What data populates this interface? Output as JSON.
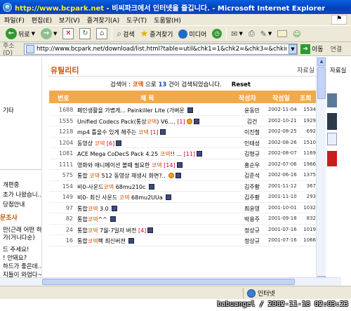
{
  "window": {
    "title": "비씨파크에서 인터넷을 즐깁니다. - Microsoft Internet Explorer",
    "title_url": "http://www.bcpark.net",
    "title_sep": " - "
  },
  "menu": {
    "items": [
      "파일(F)",
      "편집(E)",
      "보기(V)",
      "즐겨찾기(A)",
      "도구(T)",
      "도움말(H)"
    ]
  },
  "toolbar": {
    "back_label": "뒤로",
    "search_label": "검색",
    "favorites_label": "즐겨찾기",
    "media_label": "미디어"
  },
  "address": {
    "label": "주소(D)",
    "url": "http://www.bcpark.net/download/list.html?table=util&chk1=1&chk2=&chk3=&chkinum=&key=%C",
    "go_label": "이동",
    "links_label": "연결"
  },
  "left_frame": {
    "top_item": "기타",
    "items_mid": [
      "개편중",
      "초가 나왔습니..",
      "당첨안내"
    ],
    "heading": "문조사",
    "items_bottom": [
      "만(근래 어떤 하드",
      "가(거니다순)",
      "드 주세요!",
      "! 안돼요?",
      "하드가 좋은데..",
      "지들이 와멈다~"
    ]
  },
  "content": {
    "section_title": "유틸리티",
    "right_link": "자료실",
    "search": {
      "prefix": "검색어 : ",
      "keyword": "코덱",
      "middle": " 으로 ",
      "count": "13",
      "suffix": " 건이 검색되었습니다.",
      "reset": "Reset"
    },
    "table_headers": {
      "num": "번호",
      "title": "제          목",
      "writer": "작성자",
      "date": "작성일",
      "views": "조회"
    },
    "rows": [
      {
        "num": "1688",
        "pre": "페인생활을 가볍게... Painkiller Lite (가벼운 ",
        "kw": "",
        "post": "",
        "comments": "",
        "writer": "윤동민",
        "date": "2002-11-04",
        "views": "1534",
        "badge": false
      },
      {
        "num": "1555",
        "pre": "Unified Codecs Pack(통상",
        "kw": "코덱",
        "post": ") V6.... ",
        "comments": "[1]",
        "writer": "김건",
        "date": "2002-10-21",
        "views": "1929",
        "badge": true
      },
      {
        "num": "1218",
        "pre": "mp4 틀을수 있게 해주는 ",
        "kw": "코덱",
        "post": " ",
        "comments": "[1]",
        "writer": "이진철",
        "date": "2002-08-25",
        "views": "692",
        "badge": false
      },
      {
        "num": "1204",
        "pre": "동영상 ",
        "kw": "코덱",
        "post": " ",
        "comments": "[6]",
        "writer": "인태성",
        "date": "2002-08-26",
        "views": "1510",
        "badge": false
      },
      {
        "num": "1081",
        "pre": "ACE Mega CoDecS Pack 4.25 ",
        "kw": "코덱",
        "post": "!! ... ",
        "comments": "[11]",
        "writer": "김형규",
        "date": "2002-08-07",
        "views": "1169",
        "badge": false
      },
      {
        "num": "1111",
        "pre": "영화와 애니메이션 볼때 필요한 ",
        "kw": "코덱",
        "post": " ",
        "comments": "[14]",
        "writer": "홍순우",
        "date": "2002-07-06",
        "views": "1966",
        "badge": false
      },
      {
        "num": "575",
        "pre": "통합 ",
        "kw": "코덱",
        "post": " 512 동영상 재생시 화면?.. ",
        "comments": "",
        "writer": "김준석",
        "date": "2002-06-16",
        "views": "1375",
        "badge": true
      },
      {
        "num": "154",
        "pre": "비0-사운드",
        "kw": "코덱",
        "post": " 68mu210c ",
        "comments": "",
        "writer": "김주황",
        "date": "2001-11-12",
        "views": "367",
        "badge": false
      },
      {
        "num": "149",
        "pre": "비0- 최신 사운드 ",
        "kw": "코덱",
        "post": " 68mu2UUa ",
        "comments": "",
        "writer": "김주황",
        "date": "2001-11-10",
        "views": "293",
        "badge": false
      },
      {
        "num": "97",
        "pre": "통합",
        "kw": "코덱",
        "post": " 3.0 ",
        "comments": "",
        "writer": "최윤영",
        "date": "2001-10-01",
        "views": "1032",
        "badge": false
      },
      {
        "num": "82",
        "pre": "통합",
        "kw": "코덱",
        "post": "^^ ",
        "comments": "",
        "writer": "박용주",
        "date": "2001-09-18",
        "views": "832",
        "badge": false
      },
      {
        "num": "24",
        "pre": "통합",
        "kw": "코덱",
        "post": " 7월-7일자 버전 ",
        "comments": "[4]",
        "writer": "정상규",
        "date": "2001-07-16",
        "views": "1019",
        "badge": false
      },
      {
        "num": "16",
        "pre": "통합",
        "kw": "코덱",
        "post": "팩 최신버젼 ",
        "comments": "",
        "writer": "정상규",
        "date": "2001-07-16",
        "views": "1066",
        "badge": false
      }
    ]
  },
  "right_frame": {
    "link": "자료실"
  },
  "status": {
    "zone": "인터넷"
  },
  "watermark": "babuangel / 2002-11-18 02:03:23",
  "colors": {
    "accent": "#d44f00",
    "table_header": "#f2a94b",
    "titlebar": "#0240b8"
  }
}
